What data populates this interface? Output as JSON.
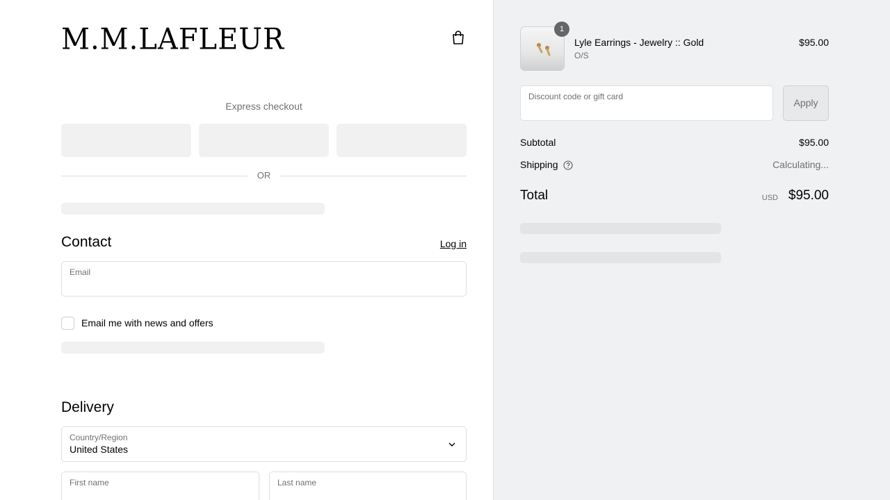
{
  "brand": {
    "logo_text": "M.M.LAFLEUR"
  },
  "header": {
    "cart_icon": "shopping-bag-icon"
  },
  "express": {
    "title": "Express checkout",
    "or_text": "OR"
  },
  "contact": {
    "title": "Contact",
    "login_label": "Log in",
    "email": {
      "label": "Email",
      "value": ""
    },
    "newsletter_label": "Email me with news and offers",
    "newsletter_checked": false
  },
  "delivery": {
    "title": "Delivery",
    "country": {
      "label": "Country/Region",
      "value": "United States"
    },
    "first_name": {
      "label": "First name",
      "value": ""
    },
    "last_name": {
      "label": "Last name",
      "value": ""
    }
  },
  "order": {
    "items": [
      {
        "name": "Lyle Earrings - Jewelry :: Gold",
        "variant": "O/S",
        "price": "$95.00",
        "quantity": "1"
      }
    ],
    "discount": {
      "placeholder": "Discount code or gift card",
      "apply_label": "Apply"
    },
    "subtotal_label": "Subtotal",
    "subtotal_value": "$95.00",
    "shipping_label": "Shipping",
    "shipping_value": "Calculating...",
    "total_label": "Total",
    "total_currency": "USD",
    "total_value": "$95.00"
  },
  "colors": {
    "sidebar_bg": "#f0f1f3",
    "border": "#dedede",
    "muted_text": "#707070",
    "badge": "#666666"
  }
}
